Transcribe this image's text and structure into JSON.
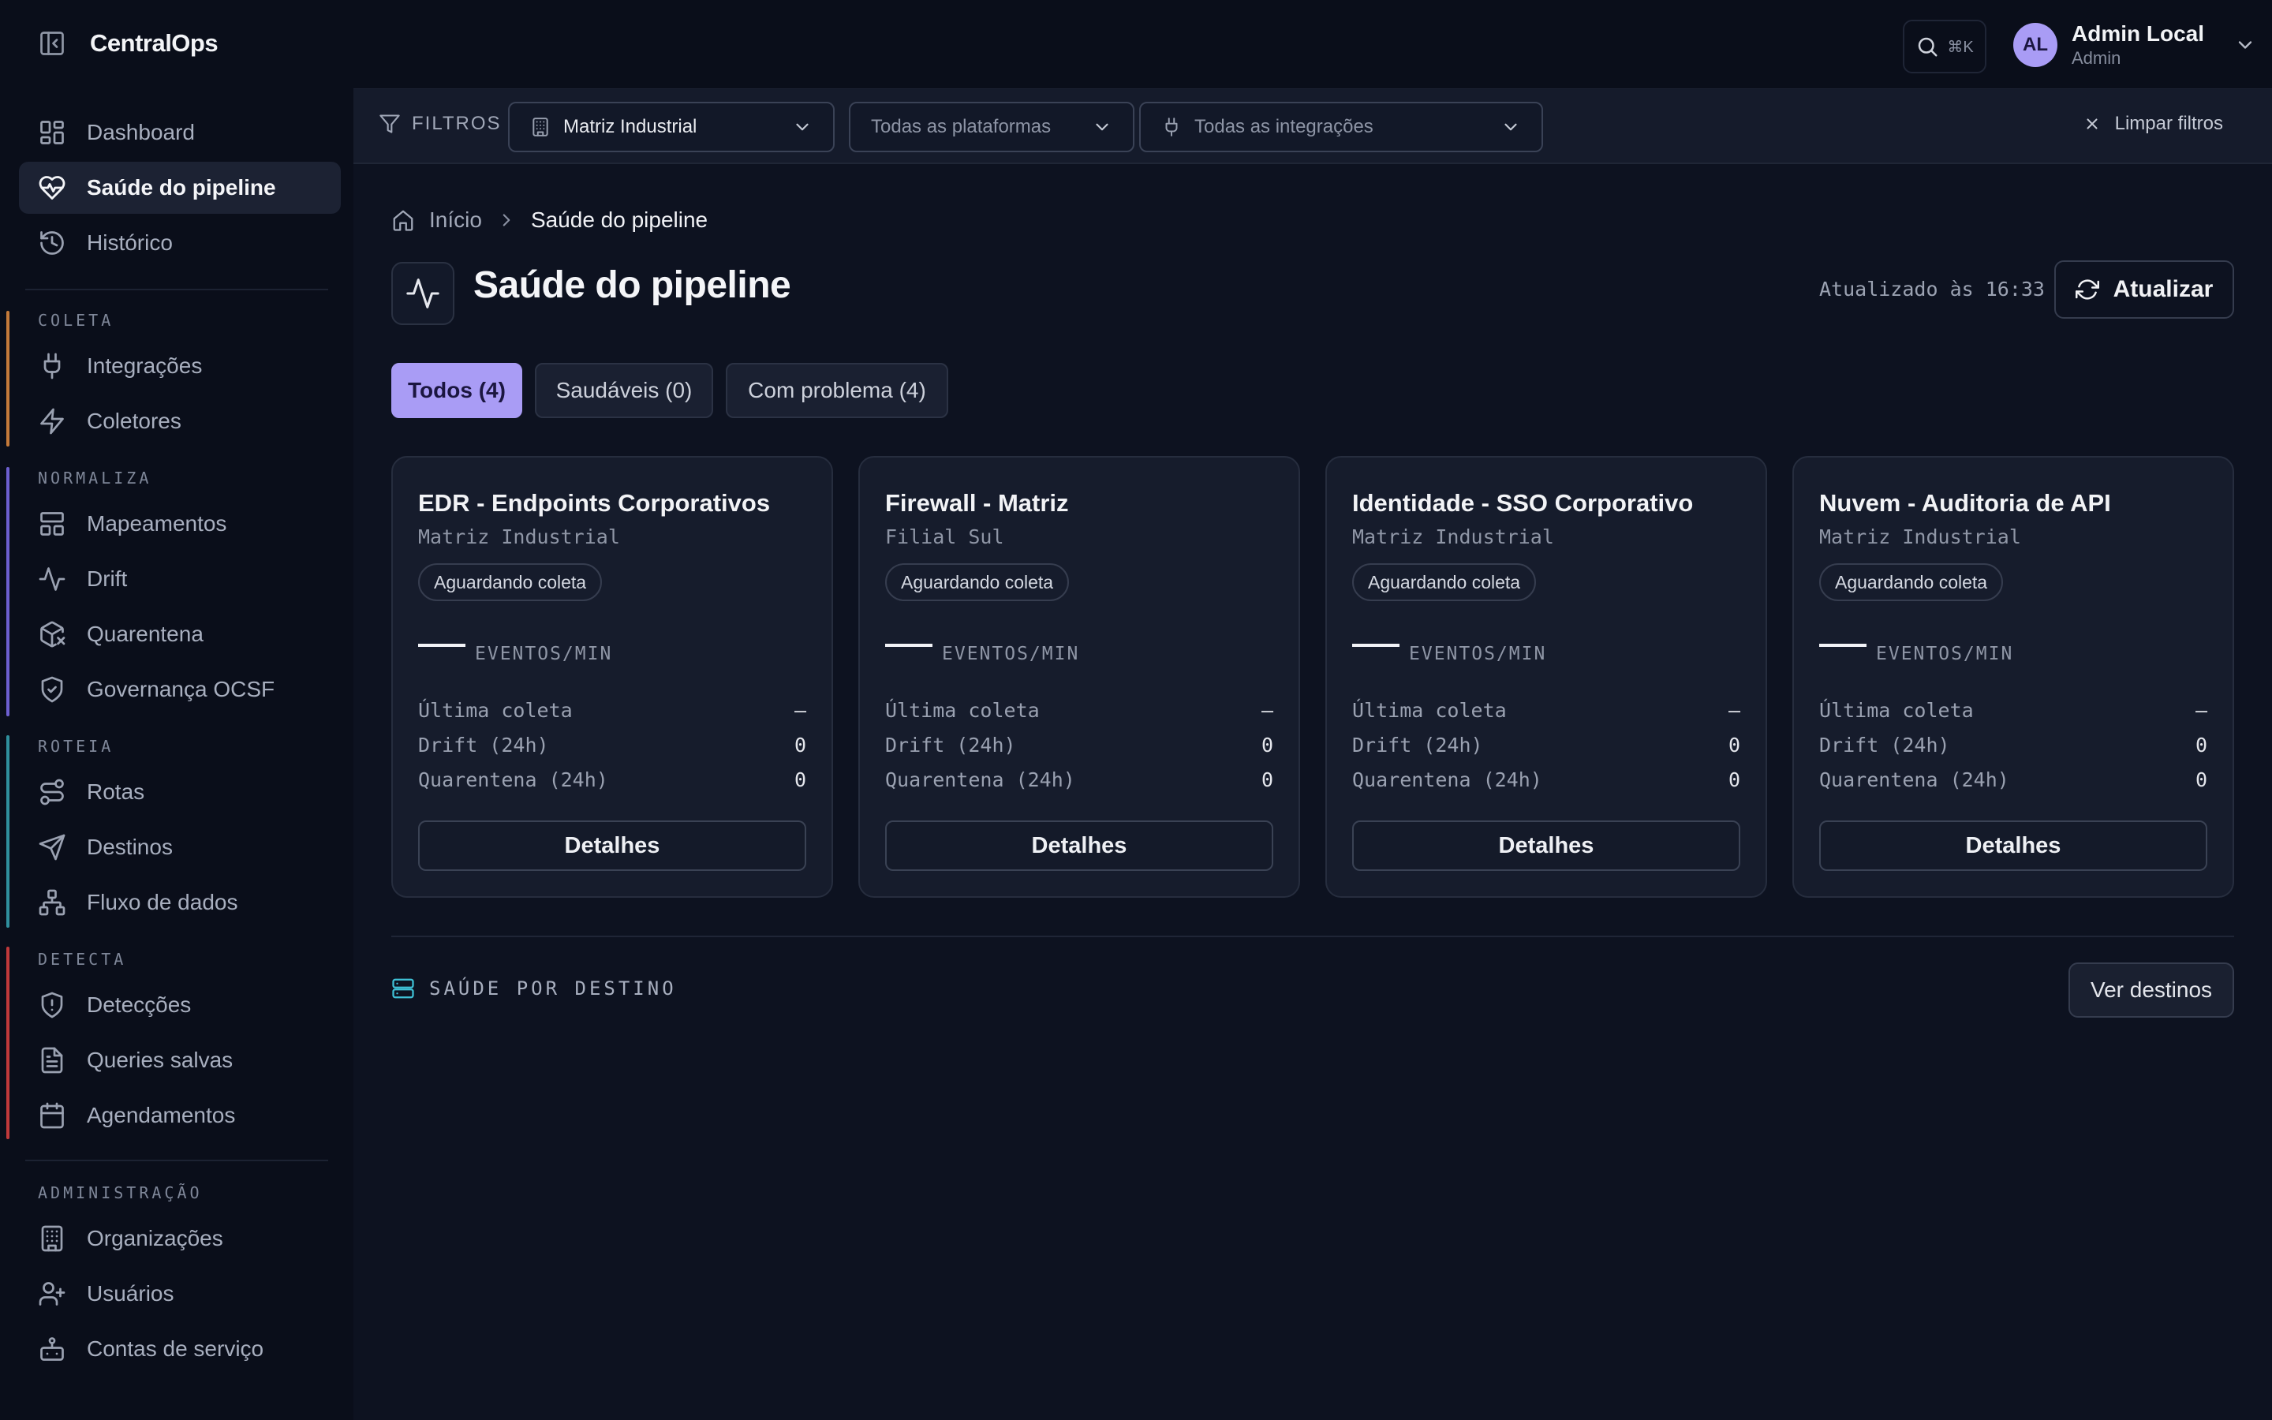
{
  "app": {
    "name": "CentralOps"
  },
  "colors": {
    "accent": "#a99cf5",
    "coleta": "#c47a3a",
    "normaliza": "#6d5fd0",
    "roteia": "#2f8f9d",
    "detecta": "#c0393b",
    "info": "#3fc1d6"
  },
  "sidebar": {
    "top": [
      {
        "label": "Dashboard",
        "icon": "dashboard-icon"
      },
      {
        "label": "Saúde do pipeline",
        "icon": "heart-pulse-icon",
        "active": true
      },
      {
        "label": "Histórico",
        "icon": "history-icon"
      }
    ],
    "sections": [
      {
        "label": "COLETA",
        "items": [
          {
            "label": "Integrações",
            "icon": "plug-icon"
          },
          {
            "label": "Coletores",
            "icon": "bolt-icon"
          }
        ]
      },
      {
        "label": "NORMALIZA",
        "items": [
          {
            "label": "Mapeamentos",
            "icon": "layout-icon"
          },
          {
            "label": "Drift",
            "icon": "activity-icon"
          },
          {
            "label": "Quarentena",
            "icon": "package-x-icon"
          },
          {
            "label": "Governança OCSF",
            "icon": "shield-check-icon"
          }
        ]
      },
      {
        "label": "ROTEIA",
        "items": [
          {
            "label": "Rotas",
            "icon": "route-icon"
          },
          {
            "label": "Destinos",
            "icon": "send-icon"
          },
          {
            "label": "Fluxo de dados",
            "icon": "network-icon"
          }
        ]
      },
      {
        "label": "DETECTA",
        "items": [
          {
            "label": "Detecções",
            "icon": "shield-alert-icon"
          },
          {
            "label": "Queries salvas",
            "icon": "file-text-icon"
          },
          {
            "label": "Agendamentos",
            "icon": "calendar-icon"
          }
        ]
      },
      {
        "label": "ADMINISTRAÇÃO",
        "items": [
          {
            "label": "Organizações",
            "icon": "building-icon"
          },
          {
            "label": "Usuários",
            "icon": "user-plus-icon"
          },
          {
            "label": "Contas de serviço",
            "icon": "bot-icon"
          }
        ]
      }
    ]
  },
  "header": {
    "search_shortcut": "⌘K",
    "user": {
      "initials": "AL",
      "name": "Admin Local",
      "role": "Admin"
    }
  },
  "filters": {
    "label": "FILTROS",
    "organization": "Matriz Industrial",
    "platform_placeholder": "Todas as plataformas",
    "integration_placeholder": "Todas as integrações",
    "clear_label": "Limpar filtros"
  },
  "breadcrumb": {
    "home": "Início",
    "current": "Saúde do pipeline"
  },
  "page": {
    "title": "Saúde do pipeline",
    "updated": "Atualizado às 16:33",
    "refresh_label": "Atualizar"
  },
  "tabs": [
    {
      "label": "Todos (4)",
      "active": true
    },
    {
      "label": "Saudáveis (0)"
    },
    {
      "label": "Com problema (4)"
    }
  ],
  "card_labels": {
    "metric_value": "—",
    "metric_unit": "EVENTOS/MIN",
    "last_collection": "Última coleta",
    "drift": "Drift (24h)",
    "quarantine": "Quarentena (24h)",
    "details": "Detalhes"
  },
  "cards": [
    {
      "title": "EDR - Endpoints Corporativos",
      "org": "Matriz Industrial",
      "status": "Aguardando coleta",
      "last_collection": "—",
      "drift": "0",
      "quarantine": "0"
    },
    {
      "title": "Firewall - Matriz",
      "org": "Filial Sul",
      "status": "Aguardando coleta",
      "last_collection": "—",
      "drift": "0",
      "quarantine": "0"
    },
    {
      "title": "Identidade - SSO Corporativo",
      "org": "Matriz Industrial",
      "status": "Aguardando coleta",
      "last_collection": "—",
      "drift": "0",
      "quarantine": "0"
    },
    {
      "title": "Nuvem - Auditoria de API",
      "org": "Matriz Industrial",
      "status": "Aguardando coleta",
      "last_collection": "—",
      "drift": "0",
      "quarantine": "0"
    }
  ],
  "destinations": {
    "label": "SAÚDE POR DESTINO",
    "button": "Ver destinos"
  }
}
